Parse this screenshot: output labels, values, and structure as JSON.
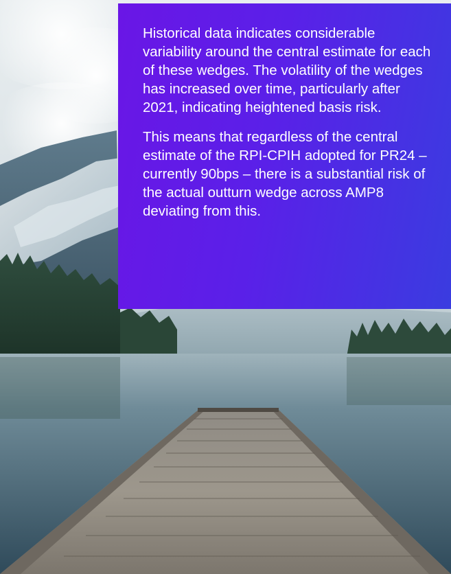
{
  "content": {
    "paragraphs": [
      "Historical data indicates considerable variability around the central estimate for each of these wedges. The volatility of the wedges has increased over time, particularly after 2021, indicating heightened basis risk.",
      "This means that regardless of the central estimate of the RPI-CPIH adopted for PR24 – currently 90bps – there is a substantial risk of the actual outturn wedge across AMP8 deviating from this."
    ]
  },
  "colors": {
    "box_gradient_start": "#6a16e6",
    "box_gradient_end": "#3a3ce0",
    "text": "#ffffff"
  }
}
